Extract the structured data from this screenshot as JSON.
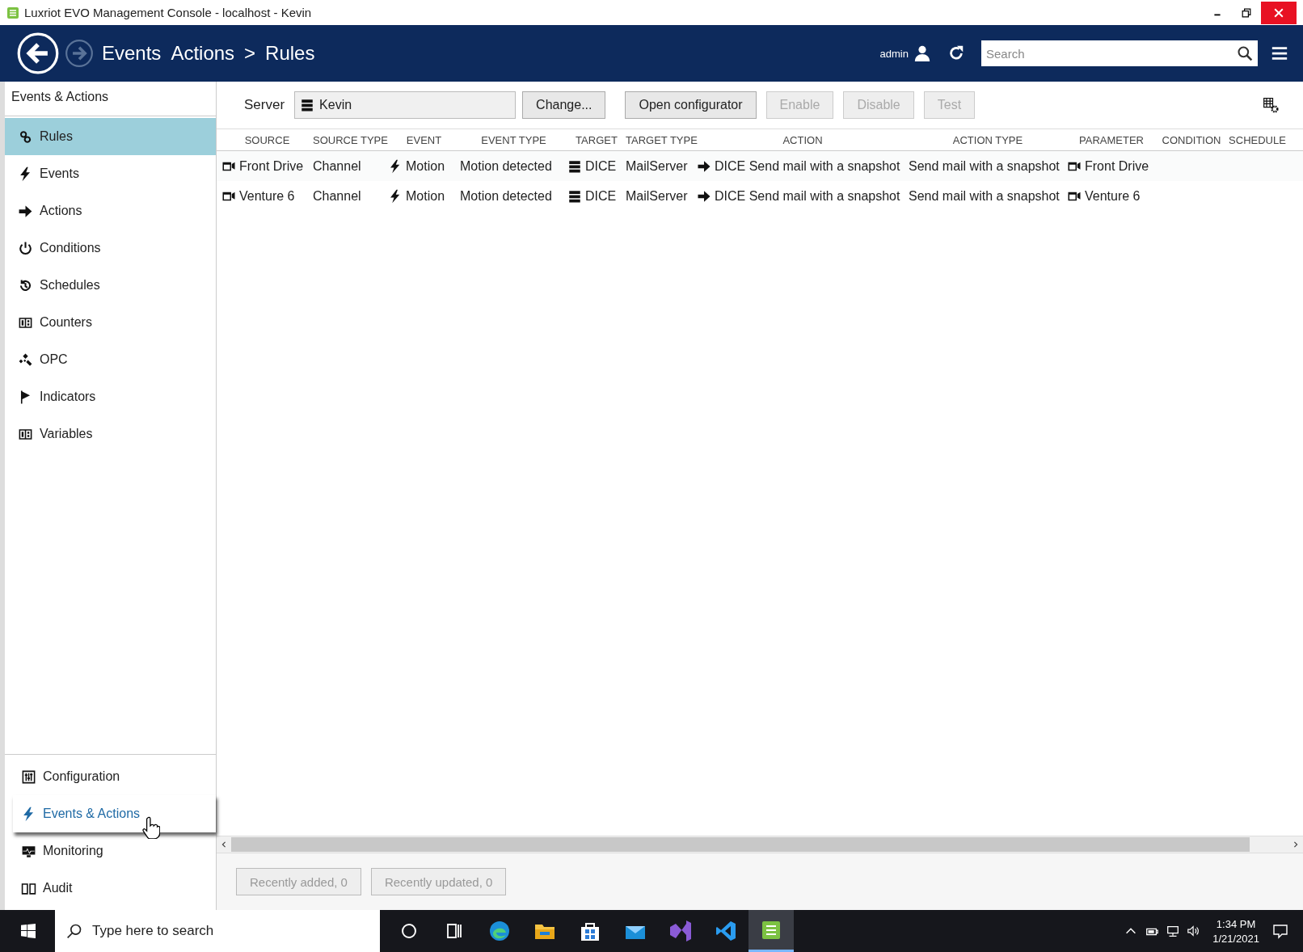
{
  "window": {
    "title": "Luxriot EVO Management Console - localhost - Kevin"
  },
  "header": {
    "breadcrumb": [
      "Events",
      "Actions",
      ">",
      "Rules"
    ],
    "user": "admin",
    "search": {
      "placeholder": "Search"
    }
  },
  "sidebar": {
    "title": "Events & Actions",
    "items": [
      {
        "label": "Rules",
        "selected": true
      },
      {
        "label": "Events",
        "selected": false
      },
      {
        "label": "Actions",
        "selected": false
      },
      {
        "label": "Conditions",
        "selected": false
      },
      {
        "label": "Schedules",
        "selected": false
      },
      {
        "label": "Counters",
        "selected": false
      },
      {
        "label": "OPC",
        "selected": false
      },
      {
        "label": "Indicators",
        "selected": false
      },
      {
        "label": "Variables",
        "selected": false
      }
    ],
    "sections": [
      {
        "label": "Configuration",
        "selected": false
      },
      {
        "label": "Events & Actions",
        "selected": true
      },
      {
        "label": "Monitoring",
        "selected": false
      },
      {
        "label": "Audit",
        "selected": false
      }
    ]
  },
  "toolbar": {
    "server_label": "Server",
    "server": "Kevin",
    "buttons": [
      {
        "label": "Change...",
        "disabled": false
      },
      {
        "label": "Open configurator",
        "disabled": false
      },
      {
        "label": "Enable",
        "disabled": true
      },
      {
        "label": "Disable",
        "disabled": true
      },
      {
        "label": "Test",
        "disabled": true
      }
    ]
  },
  "table": {
    "columns": [
      "SOURCE",
      "SOURCE TYPE",
      "EVENT",
      "EVENT TYPE",
      "TARGET",
      "TARGET TYPE",
      "ACTION",
      "ACTION TYPE",
      "PARAMETER",
      "CONDITION",
      "SCHEDULE"
    ],
    "rows": [
      {
        "cells": [
          "Front Drive",
          "Channel",
          "Motion",
          "Motion detected",
          "DICE",
          "MailServer",
          "DICE Send mail with a snapshot",
          "Send mail with a snapshot",
          "Front Drive"
        ]
      },
      {
        "cells": [
          "Venture 6",
          "Channel",
          "Motion",
          "Motion detected",
          "DICE",
          "MailServer",
          "DICE Send mail with a snapshot",
          "Send mail with a snapshot",
          "Venture 6"
        ]
      }
    ]
  },
  "footer": {
    "buttons": [
      {
        "label": "Recently added, 0",
        "disabled": true
      },
      {
        "label": "Recently updated, 0",
        "disabled": true
      }
    ]
  },
  "taskbar": {
    "search": {
      "placeholder": "Type here to search"
    },
    "apps": [
      {
        "selected": false
      },
      {
        "selected": false
      },
      {
        "selected": false
      },
      {
        "selected": false
      },
      {
        "selected": false
      },
      {
        "selected": false
      },
      {
        "selected": true
      }
    ],
    "time": "1:34 PM",
    "date": "1/21/2021"
  }
}
